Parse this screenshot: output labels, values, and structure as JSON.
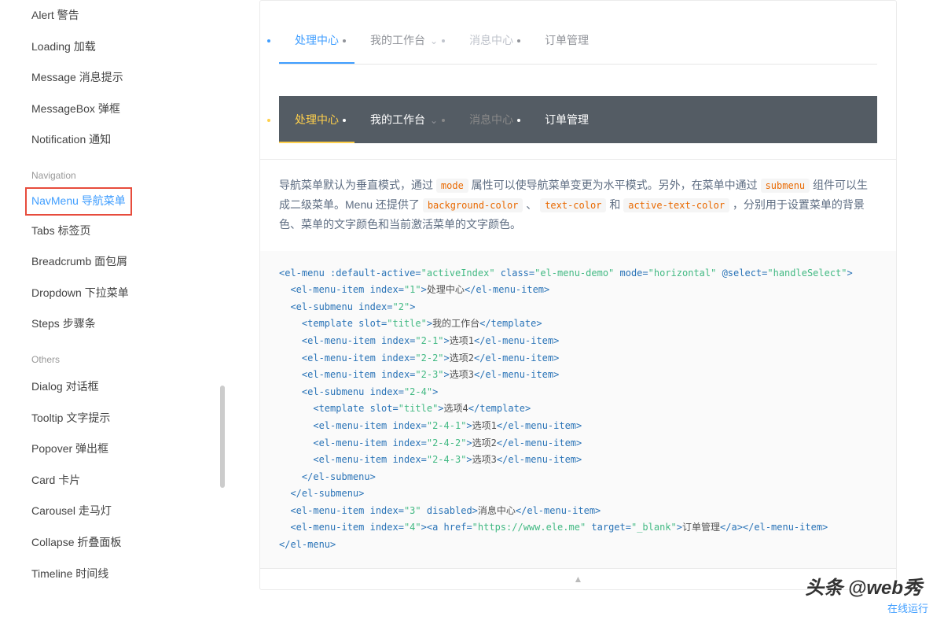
{
  "sidebar": {
    "items_top": [
      "Alert 警告",
      "Loading 加载",
      "Message 消息提示",
      "MessageBox 弹框",
      "Notification 通知"
    ],
    "group_nav": "Navigation",
    "items_nav": [
      "NavMenu 导航菜单",
      "Tabs 标签页",
      "Breadcrumb 面包屑",
      "Dropdown 下拉菜单",
      "Steps 步骤条"
    ],
    "group_others": "Others",
    "items_others": [
      "Dialog 对话框",
      "Tooltip 文字提示",
      "Popover 弹出框",
      "Card 卡片",
      "Carousel 走马灯",
      "Collapse 折叠面板",
      "Timeline 时间线"
    ]
  },
  "menu": {
    "item1": "处理中心",
    "item2": "我的工作台",
    "item3": "消息中心",
    "item4": "订单管理"
  },
  "desc": {
    "p1a": "导航菜单默认为垂直模式，通过 ",
    "c1": "mode",
    "p1b": " 属性可以使导航菜单变更为水平模式。另外，在菜单中通过 ",
    "c2": "submenu",
    "p1c": " 组件可以生成二级菜单。Menu 还提供了 ",
    "c3": "background-color",
    "p1d": " 、 ",
    "c4": "text-color",
    "p1e": " 和 ",
    "c5": "active-text-color",
    "p1f": " ，分别用于设置菜单的背景色、菜单的文字颜色和当前激活菜单的文字颜色。"
  },
  "code": {
    "l01a": "<el-menu :default-active=",
    "l01b": "\"activeIndex\"",
    "l01c": " class=",
    "l01d": "\"el-menu-demo\"",
    "l01e": " mode=",
    "l01f": "\"horizontal\"",
    "l01g": " @select=",
    "l01h": "\"handleSelect\"",
    "l01i": ">",
    "l02a": "  <el-menu-item index=",
    "l02b": "\"1\"",
    "l02c": ">",
    "l02t": "处理中心",
    "l02d": "</el-menu-item>",
    "l03a": "  <el-submenu index=",
    "l03b": "\"2\"",
    "l03c": ">",
    "l04a": "    <template slot=",
    "l04b": "\"title\"",
    "l04c": ">",
    "l04t": "我的工作台",
    "l04d": "</template>",
    "l05a": "    <el-menu-item index=",
    "l05b": "\"2-1\"",
    "l05c": ">",
    "l05t": "选项1",
    "l05d": "</el-menu-item>",
    "l06a": "    <el-menu-item index=",
    "l06b": "\"2-2\"",
    "l06c": ">",
    "l06t": "选项2",
    "l06d": "</el-menu-item>",
    "l07a": "    <el-menu-item index=",
    "l07b": "\"2-3\"",
    "l07c": ">",
    "l07t": "选项3",
    "l07d": "</el-menu-item>",
    "l08a": "    <el-submenu index=",
    "l08b": "\"2-4\"",
    "l08c": ">",
    "l09a": "      <template slot=",
    "l09b": "\"title\"",
    "l09c": ">",
    "l09t": "选项4",
    "l09d": "</template>",
    "l10a": "      <el-menu-item index=",
    "l10b": "\"2-4-1\"",
    "l10c": ">",
    "l10t": "选项1",
    "l10d": "</el-menu-item>",
    "l11a": "      <el-menu-item index=",
    "l11b": "\"2-4-2\"",
    "l11c": ">",
    "l11t": "选项2",
    "l11d": "</el-menu-item>",
    "l12a": "      <el-menu-item index=",
    "l12b": "\"2-4-3\"",
    "l12c": ">",
    "l12t": "选项3",
    "l12d": "</el-menu-item>",
    "l13": "    </el-submenu>",
    "l14": "  </el-submenu>",
    "l15a": "  <el-menu-item index=",
    "l15b": "\"3\"",
    "l15c": " disabled>",
    "l15t": "消息中心",
    "l15d": "</el-menu-item>",
    "l16a": "  <el-menu-item index=",
    "l16b": "\"4\"",
    "l16c": "><a href=",
    "l16d": "\"https://www.ele.me\"",
    "l16e": " target=",
    "l16f": "\"_blank\"",
    "l16g": ">",
    "l16t": "订单管理",
    "l16h": "</a></el-menu-item>",
    "l17": "</el-menu>"
  },
  "run_link": "在线运行",
  "watermark": "头条 @web秀",
  "arrow": "▲"
}
